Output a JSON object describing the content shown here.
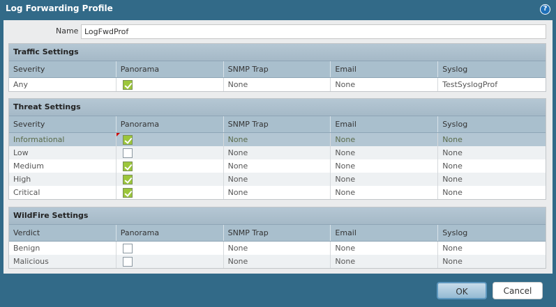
{
  "window": {
    "title": "Log Forwarding Profile",
    "help_icon": "?"
  },
  "name": {
    "label": "Name",
    "value": "LogFwdProf"
  },
  "columns": [
    "Panorama",
    "SNMP Trap",
    "Email",
    "Syslog"
  ],
  "traffic": {
    "title": "Traffic Settings",
    "first_col": "Severity",
    "rows": [
      {
        "label": "Any",
        "panorama": true,
        "snmp": "None",
        "email": "None",
        "syslog": "TestSyslogProf"
      }
    ]
  },
  "threat": {
    "title": "Threat Settings",
    "first_col": "Severity",
    "rows": [
      {
        "label": "Informational",
        "panorama": true,
        "snmp": "None",
        "email": "None",
        "syslog": "None"
      },
      {
        "label": "Low",
        "panorama": false,
        "snmp": "None",
        "email": "None",
        "syslog": "None"
      },
      {
        "label": "Medium",
        "panorama": true,
        "snmp": "None",
        "email": "None",
        "syslog": "None"
      },
      {
        "label": "High",
        "panorama": true,
        "snmp": "None",
        "email": "None",
        "syslog": "None"
      },
      {
        "label": "Critical",
        "panorama": true,
        "snmp": "None",
        "email": "None",
        "syslog": "None"
      }
    ]
  },
  "wildfire": {
    "title": "WildFire Settings",
    "first_col": "Verdict",
    "rows": [
      {
        "label": "Benign",
        "panorama": false,
        "snmp": "None",
        "email": "None",
        "syslog": "None"
      },
      {
        "label": "Malicious",
        "panorama": false,
        "snmp": "None",
        "email": "None",
        "syslog": "None"
      }
    ]
  },
  "buttons": {
    "ok": "OK",
    "cancel": "Cancel"
  }
}
